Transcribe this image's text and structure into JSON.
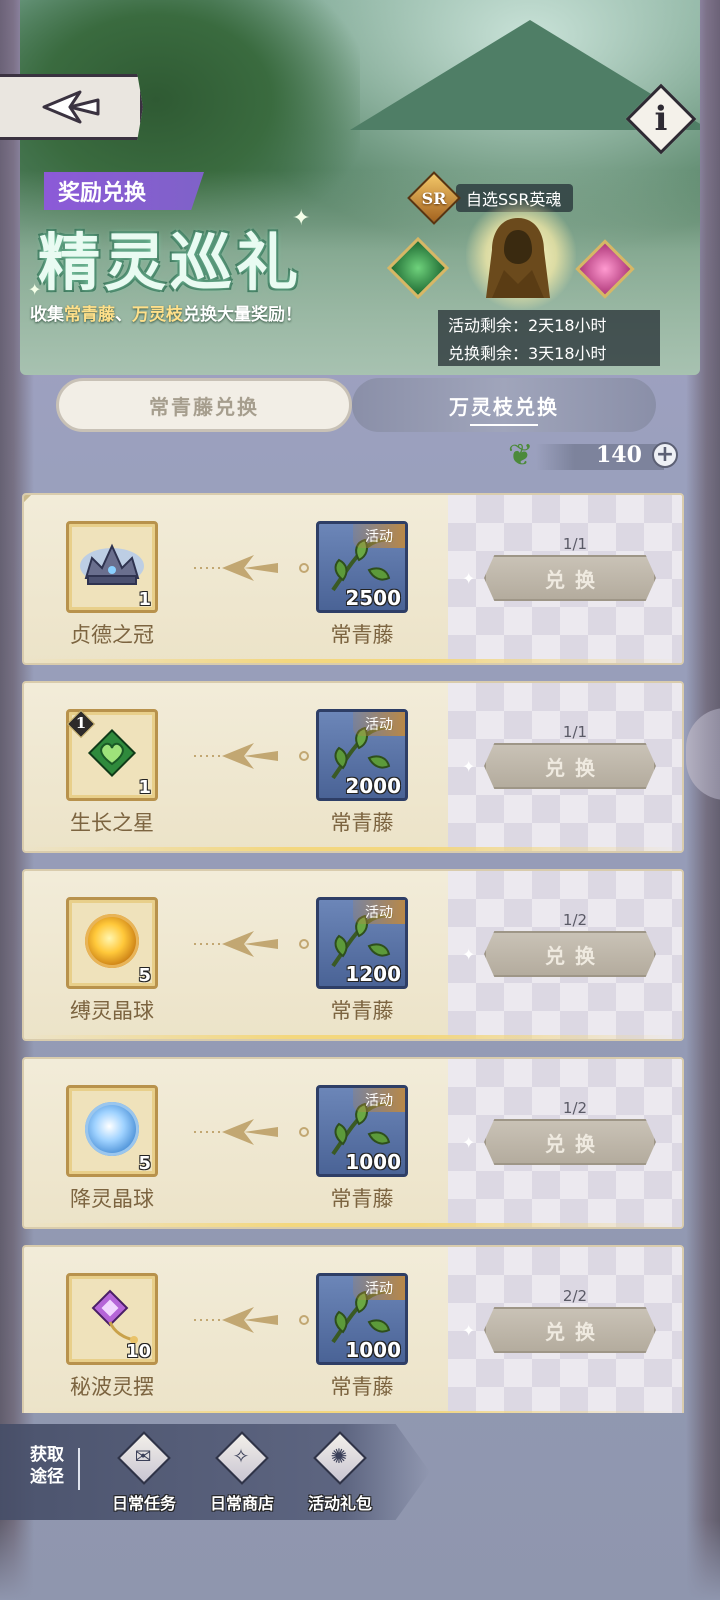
{
  "banner": {
    "tag": "奖励兑换",
    "title": "精灵巡礼",
    "subtitle_pre": "收集",
    "subtitle_hl1": "常青藤",
    "subtitle_sep": "、",
    "subtitle_hl2": "万灵枝",
    "subtitle_post": "兑换大量奖励！",
    "ssr_badge": "SR",
    "ssr_label": "自选SSR英魂",
    "activity_remaining": "活动剩余：2天18小时",
    "exchange_remaining": "兑换剩余：3天18小时"
  },
  "tabs": [
    {
      "label": "常青藤兑换",
      "active": false
    },
    {
      "label": "万灵枝兑换",
      "active": true
    }
  ],
  "currency": {
    "amount": "140",
    "plus": "+"
  },
  "rows": [
    {
      "item": "贞德之冠",
      "item_count": "1",
      "cost_name": "常青藤",
      "cost": "2500",
      "cost_badge": "活动",
      "quota": "1/1",
      "button": "兑换"
    },
    {
      "item": "生长之星",
      "item_count": "1",
      "level_tag": "1",
      "cost_name": "常青藤",
      "cost": "2000",
      "cost_badge": "活动",
      "quota": "1/1",
      "button": "兑换"
    },
    {
      "item": "缚灵晶球",
      "item_count": "5",
      "cost_name": "常青藤",
      "cost": "1200",
      "cost_badge": "活动",
      "quota": "1/2",
      "button": "兑换"
    },
    {
      "item": "降灵晶球",
      "item_count": "5",
      "cost_name": "常青藤",
      "cost": "1000",
      "cost_badge": "活动",
      "quota": "1/2",
      "button": "兑换"
    },
    {
      "item": "秘波灵摆",
      "item_count": "10",
      "cost_name": "常青藤",
      "cost": "1000",
      "cost_badge": "活动",
      "quota": "2/2",
      "button": "兑换"
    }
  ],
  "sources": {
    "label_line1": "获取",
    "label_line2": "途径",
    "items": [
      {
        "label": "日常任务",
        "icon": "task-icon"
      },
      {
        "label": "日常商店",
        "icon": "shop-icon"
      },
      {
        "label": "活动礼包",
        "icon": "gift-icon"
      }
    ]
  },
  "colors": {
    "tag_purple": "#8c5ad8",
    "highlight_yellow": "#ffe08a",
    "button_disabled": "#b4ac9e",
    "cost_slot_blue": "#4a6396"
  }
}
